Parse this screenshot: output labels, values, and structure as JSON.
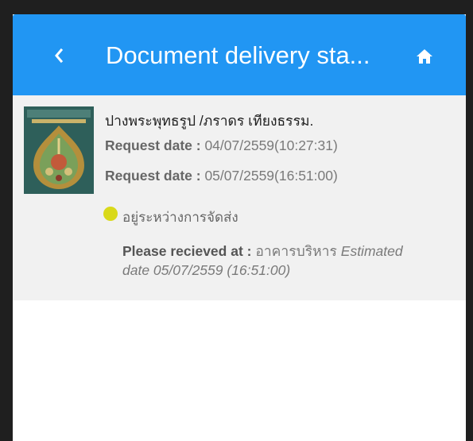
{
  "header": {
    "title": "Document delivery sta...",
    "back_icon": "chevron-left-icon",
    "home_icon": "home-icon"
  },
  "colors": {
    "app_bar": "#2196f3",
    "list_bg": "#f1f1f1",
    "status_dot": "#d9d91a"
  },
  "item": {
    "title": "ปางพระพุทธรูป /ภราดร เทียงธรรม.",
    "request_label": "Request date :",
    "request_date_1": "04/07/2559(10:27:31)",
    "request_date_2": "05/07/2559(16:51:00)",
    "status": "อยู่ระหว่างการจัดส่ง",
    "receive_label": "Please recieved at :",
    "receive_place": "อาคารบริหาร",
    "estimated_prefix": "Estimated",
    "estimated_date": "date 05/07/2559 (16:51:00)"
  }
}
